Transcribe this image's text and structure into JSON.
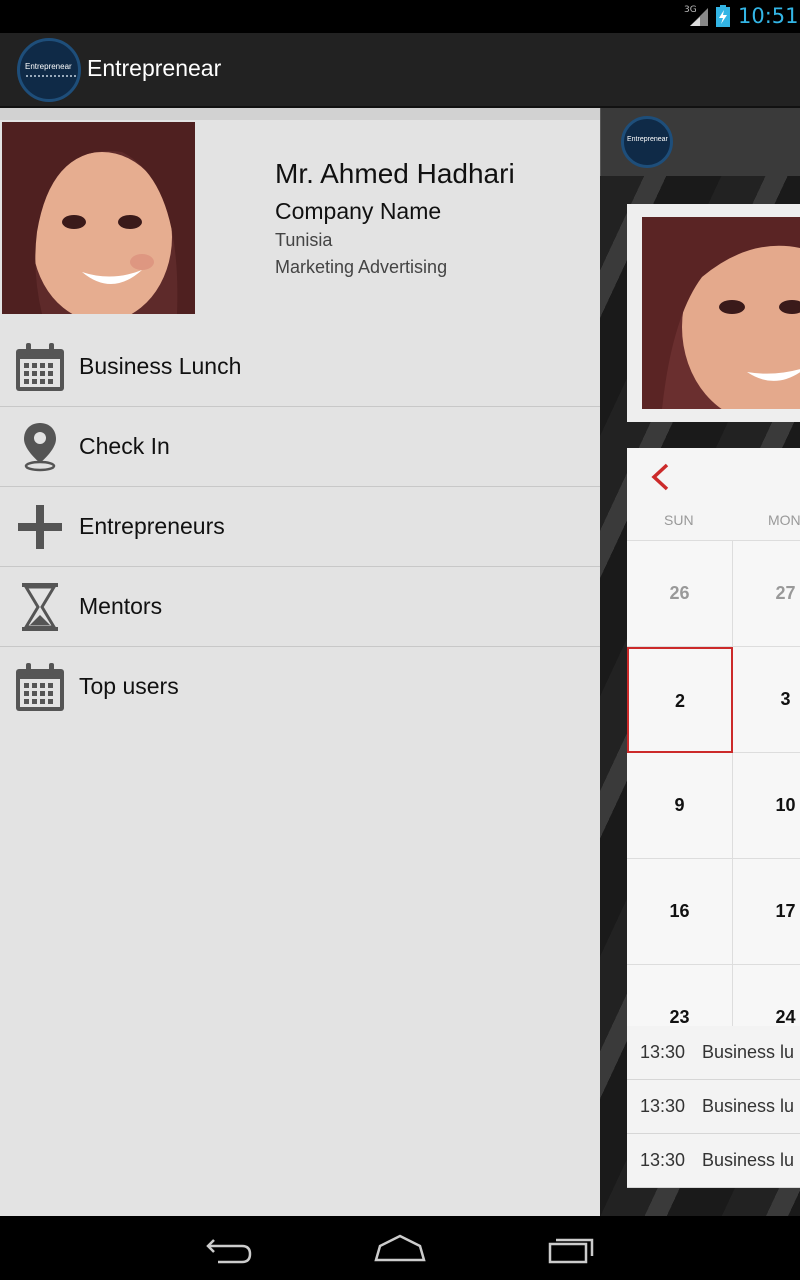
{
  "status_bar": {
    "network": "3G",
    "time": "10:51"
  },
  "app": {
    "title": "Entreprenear",
    "logo_text": "Entreprenear"
  },
  "profile": {
    "name": "Mr. Ahmed Hadhari",
    "company": "Company Name",
    "country": "Tunisia",
    "field": "Marketing Advertising"
  },
  "menu": [
    {
      "label": "Business Lunch",
      "icon": "calendar-icon"
    },
    {
      "label": "Check In",
      "icon": "location-pin-icon"
    },
    {
      "label": "Entrepreneurs",
      "icon": "plus-icon"
    },
    {
      "label": "Mentors",
      "icon": "hourglass-icon"
    },
    {
      "label": "Top users",
      "icon": "calendar-icon"
    }
  ],
  "calendar": {
    "day_names": [
      "SUN",
      "MON"
    ],
    "rows": [
      [
        "26",
        "27"
      ],
      [
        "2",
        "3"
      ],
      [
        "9",
        "10"
      ],
      [
        "16",
        "17"
      ],
      [
        "23",
        "24"
      ]
    ],
    "selected_day": "2",
    "accent_color": "#cc2a2a"
  },
  "events": [
    {
      "time": "13:30",
      "title": "Business lu"
    },
    {
      "time": "13:30",
      "title": "Business lu"
    },
    {
      "time": "13:30",
      "title": "Business lu"
    }
  ],
  "colors": {
    "clock": "#33b5e5",
    "action_bar": "#222222",
    "drawer": "#e3e3e3"
  }
}
